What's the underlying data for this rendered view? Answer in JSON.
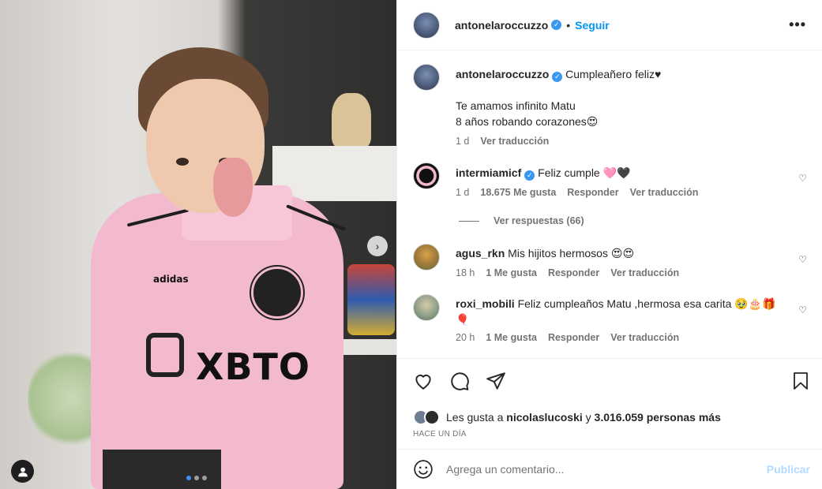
{
  "header": {
    "username": "antonelaroccuzzo",
    "separator": "•",
    "follow_label": "Seguir",
    "more_label": "•••"
  },
  "caption": {
    "username": "antonelaroccuzzo",
    "line1": "Cumpleañero feliz♥",
    "line2": "Te amamos infinito Matu",
    "line3": "8 años robando corazones😍",
    "time": "1 d",
    "translate": "Ver traducción"
  },
  "comments": [
    {
      "username": "intermiamicf",
      "text": "Feliz cumple 🩷🖤",
      "time": "1 d",
      "likes": "18.675 Me gusta",
      "reply": "Responder",
      "translate": "Ver traducción",
      "view_replies": "Ver respuestas (66)"
    },
    {
      "username": "agus_rkn",
      "text": "Mis hijitos hermosos 😍😍",
      "time": "18 h",
      "likes": "1 Me gusta",
      "reply": "Responder",
      "translate": "Ver traducción"
    },
    {
      "username": "roxi_mobili",
      "text": "Feliz cumpleaños Matu ,hermosa esa carita 🥹🎂🎁",
      "text2": "🎈",
      "time": "20 h",
      "likes": "1 Me gusta",
      "reply": "Responder",
      "translate": "Ver traducción"
    }
  ],
  "likes": {
    "prefix": "Les gusta a",
    "user": "nicolaslucoski",
    "middle": "y",
    "count": "3.016.059 personas más"
  },
  "date": "HACE UN DÍA",
  "add_comment": {
    "placeholder": "Agrega un comentario...",
    "publish": "Publicar"
  },
  "media": {
    "shirt_text": "XBTO",
    "brand_text": "adidas",
    "slide_count": 3,
    "active_slide": 1
  },
  "colors": {
    "accent": "#0095f6",
    "verified": "#3897f0",
    "shirt_pink": "#f2b9cf"
  },
  "icons": [
    "heart-icon",
    "comment-icon",
    "share-icon",
    "bookmark-icon",
    "emoji-icon",
    "more-icon",
    "chevron-right-icon",
    "user-tag-icon",
    "verified-icon"
  ]
}
